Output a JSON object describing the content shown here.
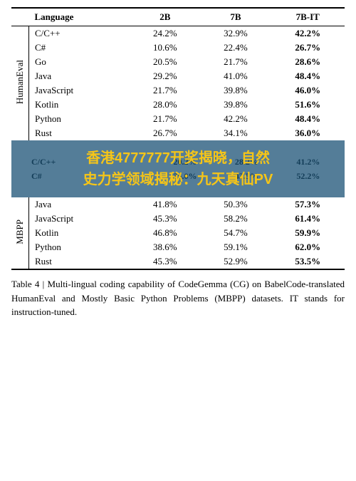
{
  "table": {
    "title": "Table 4",
    "caption": "Table 4 | Multi-lingual coding capability of CodeGemma (CG) on BabelCode-translated HumanEval and Mostly Basic Python Problems (MBPP) datasets. IT stands for instruction-tuned.",
    "headers": [
      "Language",
      "2B",
      "7B",
      "7B-IT"
    ],
    "sections": [
      {
        "label": "HumanEval",
        "rows": [
          {
            "lang": "C/C++",
            "b2": "24.2%",
            "b7": "32.9%",
            "it": "42.2%"
          },
          {
            "lang": "C#",
            "b2": "10.6%",
            "b7": "22.4%",
            "it": "26.7%"
          },
          {
            "lang": "Go",
            "b2": "20.5%",
            "b7": "21.7%",
            "it": "28.6%"
          },
          {
            "lang": "Java",
            "b2": "29.2%",
            "b7": "41.0%",
            "it": "48.4%"
          },
          {
            "lang": "JavaScript",
            "b2": "21.7%",
            "b7": "39.8%",
            "it": "46.0%"
          },
          {
            "lang": "Kotlin",
            "b2": "28.0%",
            "b7": "39.8%",
            "it": "51.6%"
          },
          {
            "lang": "Python",
            "b2": "21.7%",
            "b7": "42.2%",
            "it": "48.4%"
          },
          {
            "lang": "Rust",
            "b2": "26.7%",
            "b7": "34.1%",
            "it": "36.0%"
          }
        ]
      },
      {
        "label": "MBPP",
        "blurred_rows": [
          {
            "lang": "C/C++",
            "b2": "20.2%",
            "b7": "28.2%",
            "it": "41.2%"
          },
          {
            "lang": "C#",
            "b2": "35.0%",
            "b7": "43.5%",
            "it": "52.2%"
          }
        ],
        "rows": [
          {
            "lang": "Java",
            "b2": "41.8%",
            "b7": "50.3%",
            "it": "57.3%"
          },
          {
            "lang": "JavaScript",
            "b2": "45.3%",
            "b7": "58.2%",
            "it": "61.4%"
          },
          {
            "lang": "Kotlin",
            "b2": "46.8%",
            "b7": "54.7%",
            "it": "59.9%"
          },
          {
            "lang": "Python",
            "b2": "38.6%",
            "b7": "59.1%",
            "it": "62.0%"
          },
          {
            "lang": "Rust",
            "b2": "45.3%",
            "b7": "52.9%",
            "it": "53.5%"
          }
        ]
      }
    ],
    "ad": {
      "line1": "香港4777777开奖揭晓，自然",
      "line2": "史力学领域揭秘：九天真仙PV"
    }
  }
}
